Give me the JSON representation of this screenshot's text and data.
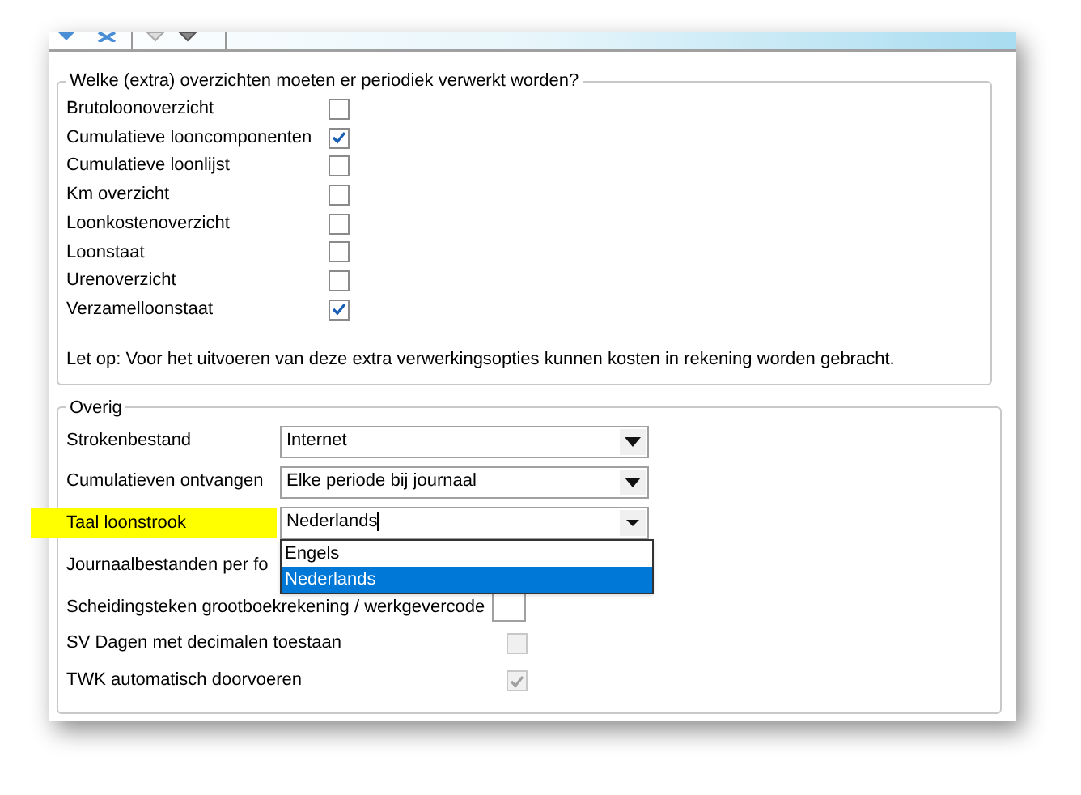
{
  "overviews": {
    "legend": "Welke (extra) overzichten moeten er periodiek verwerkt worden?",
    "items": [
      {
        "label": "Brutoloonoverzicht",
        "checked": false
      },
      {
        "label": "Cumulatieve looncomponenten",
        "checked": true
      },
      {
        "label": "Cumulatieve loonlijst",
        "checked": false
      },
      {
        "label": "Km overzicht",
        "checked": false
      },
      {
        "label": "Loonkostenoverzicht",
        "checked": false
      },
      {
        "label": "Loonstaat",
        "checked": false
      },
      {
        "label": "Urenoverzicht",
        "checked": false
      },
      {
        "label": "Verzamelloonstaat",
        "checked": true
      }
    ],
    "note": "Let op: Voor het uitvoeren van deze extra verwerkingsopties kunnen kosten in rekening worden gebracht."
  },
  "other": {
    "legend": "Overig",
    "rows": [
      {
        "kind": "select",
        "label": "Strokenbestand",
        "value": "Internet",
        "highlighted": false
      },
      {
        "kind": "select",
        "label": "Cumulatieven ontvangen",
        "value": "Elke periode bij journaal",
        "highlighted": false
      },
      {
        "kind": "select",
        "label": "Taal loonstrook",
        "value": "Nederlands",
        "highlighted": true,
        "open": true,
        "options": [
          {
            "label": "Engels",
            "selected": false
          },
          {
            "label": "Nederlands",
            "selected": true
          }
        ]
      },
      {
        "kind": "label",
        "label": "Journaalbestanden per fo"
      },
      {
        "kind": "text",
        "label": "Scheidingsteken grootboekrekening / werkgevercode"
      },
      {
        "kind": "checkbox",
        "label": "SV Dagen met decimalen toestaan",
        "checked": false,
        "disabled": true
      },
      {
        "kind": "checkbox",
        "label": "TWK automatisch doorvoeren",
        "checked": true,
        "disabled": true
      }
    ]
  }
}
